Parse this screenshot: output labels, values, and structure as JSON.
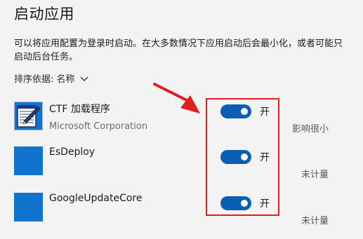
{
  "page": {
    "title": "启动应用",
    "description": "可以将应用配置为登录时启动。在大多数情况下应用启动后会最小化，或者可能只启动后台任务。",
    "sort_label": "排序依据: 名称"
  },
  "apps": [
    {
      "name": "CTF 加载程序",
      "publisher": "Microsoft Corporation",
      "toggle_label": "开",
      "impact": "影响很小",
      "enabled": true,
      "icon": "notepad-pen-icon"
    },
    {
      "name": "EsDeploy",
      "publisher": "",
      "toggle_label": "开",
      "impact": "未计量",
      "enabled": true,
      "icon": "blue-square-icon"
    },
    {
      "name": "GoogleUpdateCore",
      "publisher": "",
      "toggle_label": "开",
      "impact": "未计量",
      "enabled": true,
      "icon": "blue-square-icon"
    }
  ],
  "annotation": {
    "highlight_color": "#e02020",
    "arrow_color": "#e02020"
  },
  "colors": {
    "toggle_on": "#0a5fb4",
    "app_icon_blue": "#1073cd"
  }
}
